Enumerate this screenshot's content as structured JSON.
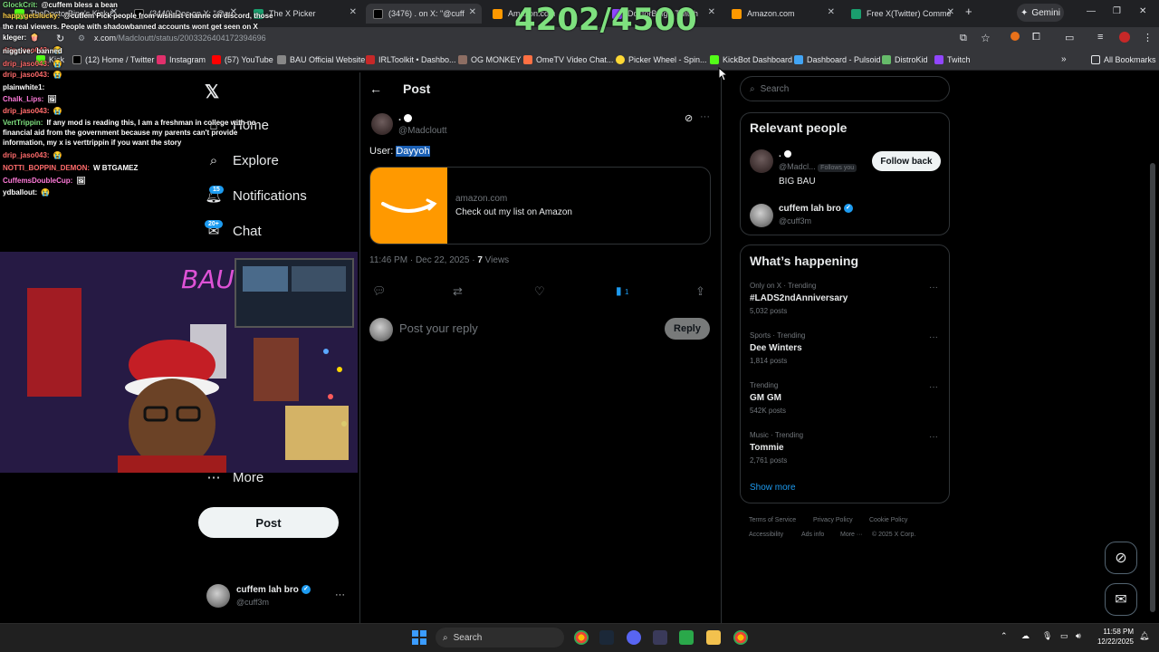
{
  "browser": {
    "tabs": [
      {
        "label": "TheDoctorBing's Kick C",
        "favicon_color": "#53fc18"
      },
      {
        "label": "(3440) Doc on X: \"@cu",
        "favicon_color": "#000000"
      },
      {
        "label": "The X Picker",
        "favicon_color": "#1a9e6e"
      },
      {
        "label": "(3476) . on X: \"@cuff",
        "favicon_color": "#000000"
      },
      {
        "label": "Amazon.com",
        "favicon_color": "#ff9900"
      },
      {
        "label": "DoctorBing - Twitch",
        "favicon_color": "#9146ff"
      },
      {
        "label": "Amazon.com",
        "favicon_color": "#ff9900"
      },
      {
        "label": "Free X(Twitter) Comme",
        "favicon_color": "#1a9e6e"
      }
    ],
    "new_tab": "+",
    "gemini_label": "Gemini",
    "url_host": "x.com",
    "url_path": "/Madcloutt/status/2003326404172394696",
    "bookmarks": [
      {
        "label": "Kick",
        "color": "#53fc18"
      },
      {
        "label": "(12) Home / Twitter",
        "color": "#000000"
      },
      {
        "label": "Instagram",
        "color": "#e1306c"
      },
      {
        "label": "(57) YouTube",
        "color": "#ff0000"
      },
      {
        "label": "BAU Official Website",
        "color": "#888888"
      },
      {
        "label": "IRLToolkit • Dashbo...",
        "color": "#c62828"
      },
      {
        "label": "OG MONKEY",
        "color": "#8d6e63"
      },
      {
        "label": "OmeTV Video Chat...",
        "color": "#ff7043"
      },
      {
        "label": "Picker Wheel - Spin...",
        "color": "#fdd835"
      },
      {
        "label": "KickBot Dashboard",
        "color": "#53fc18"
      },
      {
        "label": "Dashboard - Pulsoid",
        "color": "#42a5f5"
      },
      {
        "label": "DistroKid",
        "color": "#66bb6a"
      },
      {
        "label": "Twitch",
        "color": "#9146ff"
      }
    ],
    "all_bookmarks": "All Bookmarks"
  },
  "overlay": {
    "counter": "4202/4500",
    "chat": [
      {
        "user": "GlockCrit:",
        "color": "#7ee07e",
        "msg": "@cuffem bless a bean"
      },
      {
        "user": "happygetslucky:",
        "color": "#ffd24d",
        "msg": "@cuffem Pick people from wishlist channe on discord, those"
      },
      {
        "user": "",
        "color": "#ffffff",
        "msg": "the real viewers. People with shadowbanned accounts wont get seen on X"
      },
      {
        "user": "kleger:",
        "color": "#ffffff",
        "msg": "🍿"
      },
      {
        "user": "drip_jaso043:",
        "color": "#ff6b6b",
        "msg": "😭"
      },
      {
        "user": "drip_jaso043:",
        "color": "#ff6b6b",
        "msg": "😭"
      },
      {
        "user": "niggtive:",
        "color": "#ffffff",
        "msg": "banned"
      },
      {
        "user": "drip_jaso043:",
        "color": "#ff6b6b",
        "msg": "😭"
      },
      {
        "user": "drip_jaso043:",
        "color": "#ff6b6b",
        "msg": "😭"
      },
      {
        "user": "plainwhite1:",
        "color": "#ffffff",
        "msg": ""
      },
      {
        "user": "Chalk_Lips:",
        "color": "#ff7ad9",
        "msg": "🖼"
      },
      {
        "user": "drip_jaso043:",
        "color": "#ff6b6b",
        "msg": "😭"
      },
      {
        "user": "VertTrippin:",
        "color": "#7ee07e",
        "msg": "If any mod is reading this, I am a freshman in college with no"
      },
      {
        "user": "",
        "color": "#ffffff",
        "msg": "financial aid from the government because my parents can't provide"
      },
      {
        "user": "",
        "color": "#ffffff",
        "msg": "information, my x is verttrippin if you want the story"
      },
      {
        "user": "drip_jaso043:",
        "color": "#ff6b6b",
        "msg": "😭"
      },
      {
        "user": "NOTTI_BOPPIN_DEMON:",
        "color": "#ff6b6b",
        "msg": "W BTGAMEZ"
      },
      {
        "user": "CuffemsDoubleCup:",
        "color": "#ff7ad9",
        "msg": "🖼"
      },
      {
        "user": "ydballout:",
        "color": "#ffffff",
        "msg": "😭"
      }
    ]
  },
  "xnav": {
    "home": "Home",
    "explore": "Explore",
    "notifications": "Notifications",
    "notifications_badge": "15",
    "chat": "Chat",
    "chat_badge": "20+",
    "more": "More",
    "post_button": "Post",
    "account_name": "cuffem lah bro",
    "account_handle": "@cuff3m",
    "account_more": "···"
  },
  "post": {
    "header": "Post",
    "display_name": ".",
    "handle": "@Madcloutt",
    "text_prefix": "User: ",
    "text_highlight": "Dayyoh",
    "card_domain": "amazon.com",
    "card_title": "Check out my list on Amazon",
    "timestamp": "11:46 PM · Dec 22, 2025",
    "views_count": "7",
    "views_label": "Views",
    "bookmark_count": "1",
    "reply_placeholder": "Post your reply",
    "reply_button": "Reply",
    "more": "···"
  },
  "right": {
    "search_placeholder": "Search",
    "relevant_title": "Relevant people",
    "people": [
      {
        "name": ".",
        "handle": "@Madcl...",
        "follows_you": "Follows you",
        "bio": "BIG BAU",
        "button": "Follow back"
      },
      {
        "name": "cuffem lah bro",
        "handle": "@cuff3m"
      }
    ],
    "happening_title": "What’s happening",
    "trends": [
      {
        "meta": "Only on X · Trending",
        "name": "#LADS2ndAnniversary",
        "posts": "5,032 posts"
      },
      {
        "meta": "Sports · Trending",
        "name": "Dee Winters",
        "posts": "1,814 posts"
      },
      {
        "meta": "Trending",
        "name": "GM GM",
        "posts": "542K posts"
      },
      {
        "meta": "Music · Trending",
        "name": "Tommie",
        "posts": "2,761 posts"
      }
    ],
    "show_more": "Show more",
    "footer": [
      "Terms of Service",
      "Privacy Policy",
      "Cookie Policy",
      "Accessibility",
      "Ads info",
      "More ···",
      "© 2025 X Corp."
    ]
  },
  "taskbar": {
    "search": "Search",
    "time": "11:58 PM",
    "date": "12/22/2025"
  }
}
